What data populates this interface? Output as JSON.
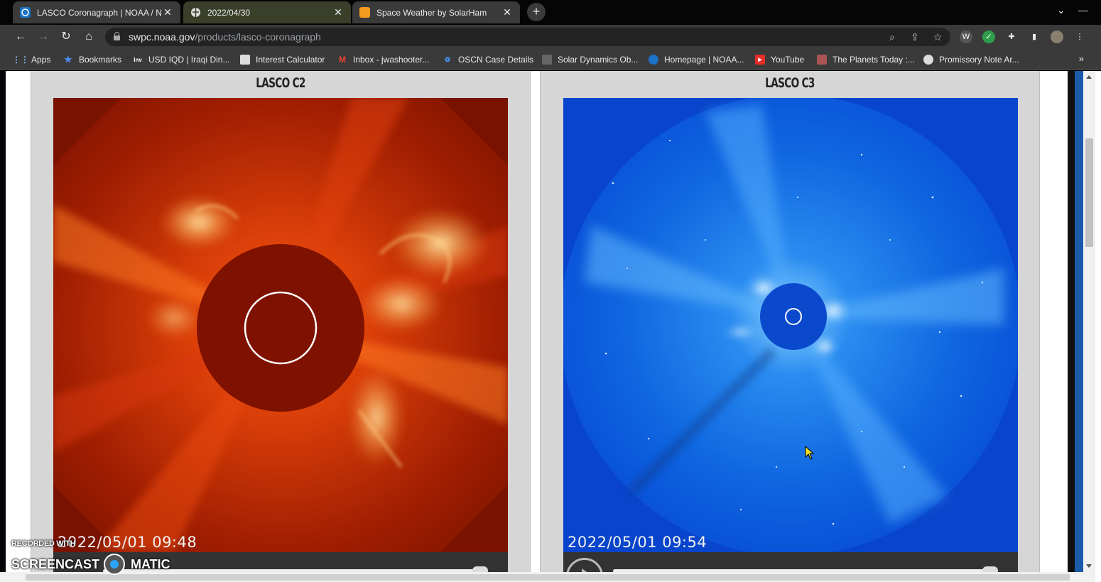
{
  "tabs": [
    {
      "title": "LASCO Coronagraph | NOAA / N",
      "favicon": "noaa-icon"
    },
    {
      "title": "2022/04/30",
      "favicon": "globe-icon"
    },
    {
      "title": "Space Weather by SolarHam",
      "favicon": "solarham-icon"
    }
  ],
  "address": {
    "domain": "swpc.noaa.gov",
    "path": "/products/lasco-coronagraph"
  },
  "bookmarks": [
    {
      "label": "Apps",
      "icon": "apps-grid-icon"
    },
    {
      "label": "Bookmarks",
      "icon": "star-icon"
    },
    {
      "label": "USD IQD | Iraqi Din...",
      "icon": "inv-icon"
    },
    {
      "label": "Interest Calculator",
      "icon": "calculator-icon"
    },
    {
      "label": "Inbox - jwashooter...",
      "icon": "gmail-icon"
    },
    {
      "label": "OSCN Case Details",
      "icon": "oscn-icon"
    },
    {
      "label": "Solar Dynamics Ob...",
      "icon": "sdo-icon"
    },
    {
      "label": "Homepage | NOAA...",
      "icon": "noaa-icon"
    },
    {
      "label": "YouTube",
      "icon": "youtube-icon"
    },
    {
      "label": "The Planets Today :...",
      "icon": "planets-icon"
    },
    {
      "label": "Promissory Note Ar...",
      "icon": "doc-icon"
    }
  ],
  "panels": {
    "c2": {
      "title": "LASCO C2",
      "timestamp": "2022/05/01  09:48"
    },
    "c3": {
      "title": "LASCO C3",
      "timestamp": "2022/05/01  09:54"
    }
  },
  "watermark": {
    "top": "RECORDED WITH",
    "left": "SCREENCAST",
    "right": "MATIC"
  },
  "colors": {
    "c2_base": "#8a1400",
    "c3_base": "#0a48d8",
    "chrome_bg": "#3a3a3a"
  }
}
